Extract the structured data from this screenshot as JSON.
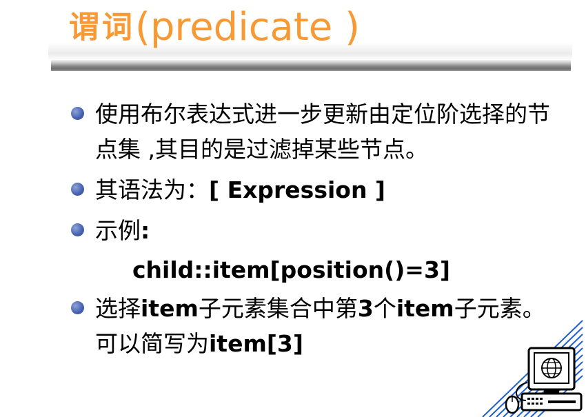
{
  "title": {
    "cjk": "谓词",
    "latin": "(predicate )"
  },
  "bullets": [
    {
      "segments": [
        {
          "text": "使用布尔表达式进一步更新由定位阶选择的节点集 ,其目的是过滤掉某些节点。",
          "bold": false
        }
      ]
    },
    {
      "segments": [
        {
          "text": "其语法为：",
          "bold": false
        },
        {
          "text": "[ Expression ]",
          "bold": true
        }
      ]
    },
    {
      "segments": [
        {
          "text": "示例",
          "bold": false
        },
        {
          "text": ":",
          "bold": true
        }
      ]
    }
  ],
  "example": "child::item[position()=3]",
  "last_bullet": {
    "segments": [
      {
        "text": "选择",
        "bold": false
      },
      {
        "text": "item",
        "bold": true
      },
      {
        "text": "子元素集合中第",
        "bold": false
      },
      {
        "text": "3",
        "bold": true
      },
      {
        "text": "个",
        "bold": false
      },
      {
        "text": "item",
        "bold": true
      },
      {
        "text": "子元素。可以简写为",
        "bold": false
      },
      {
        "text": "item[3]",
        "bold": true
      }
    ]
  },
  "clipart_icon": "computer-globe-icon",
  "colors": {
    "title": "#f79a36",
    "bullet": "#4a64b4",
    "clipart_lines": "#1f5fd1"
  }
}
